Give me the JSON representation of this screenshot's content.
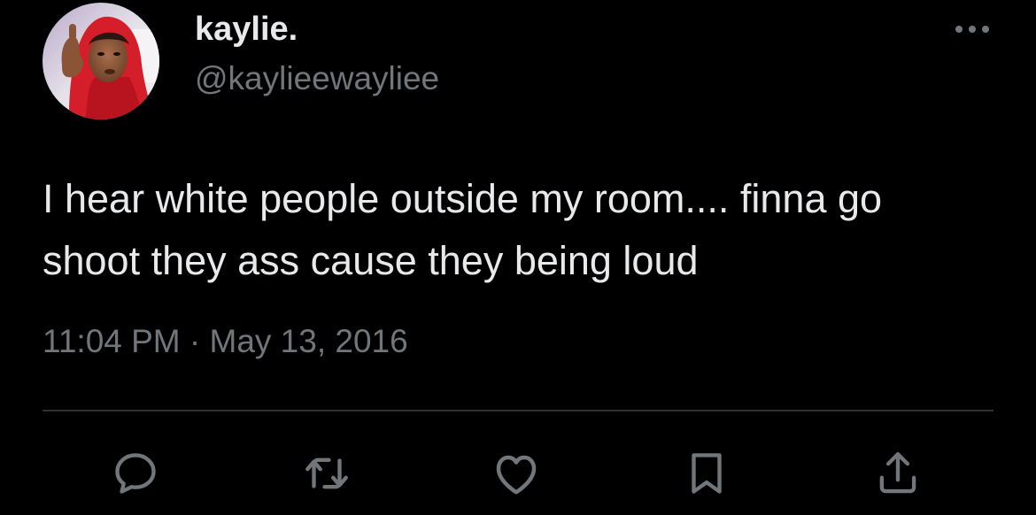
{
  "author": {
    "display_name": "kaylie.",
    "handle": "@kaylieewayliee",
    "avatar": "profile-photo"
  },
  "tweet": {
    "text_lines": [
      "I hear white people outside my room.... finna go",
      "shoot they ass cause they being loud"
    ],
    "timestamp": "11:04 PM · May 13, 2016"
  },
  "actions": [
    {
      "name": "reply",
      "icon": "reply-icon"
    },
    {
      "name": "retweet",
      "icon": "retweet-icon"
    },
    {
      "name": "like",
      "icon": "heart-icon"
    },
    {
      "name": "bookmark",
      "icon": "bookmark-icon"
    },
    {
      "name": "share",
      "icon": "share-icon"
    }
  ],
  "colors": {
    "background": "#000000",
    "primary_text": "#e7e9ea",
    "secondary_text": "#71767b",
    "divider": "#2f3336",
    "icon": "#71767b"
  }
}
